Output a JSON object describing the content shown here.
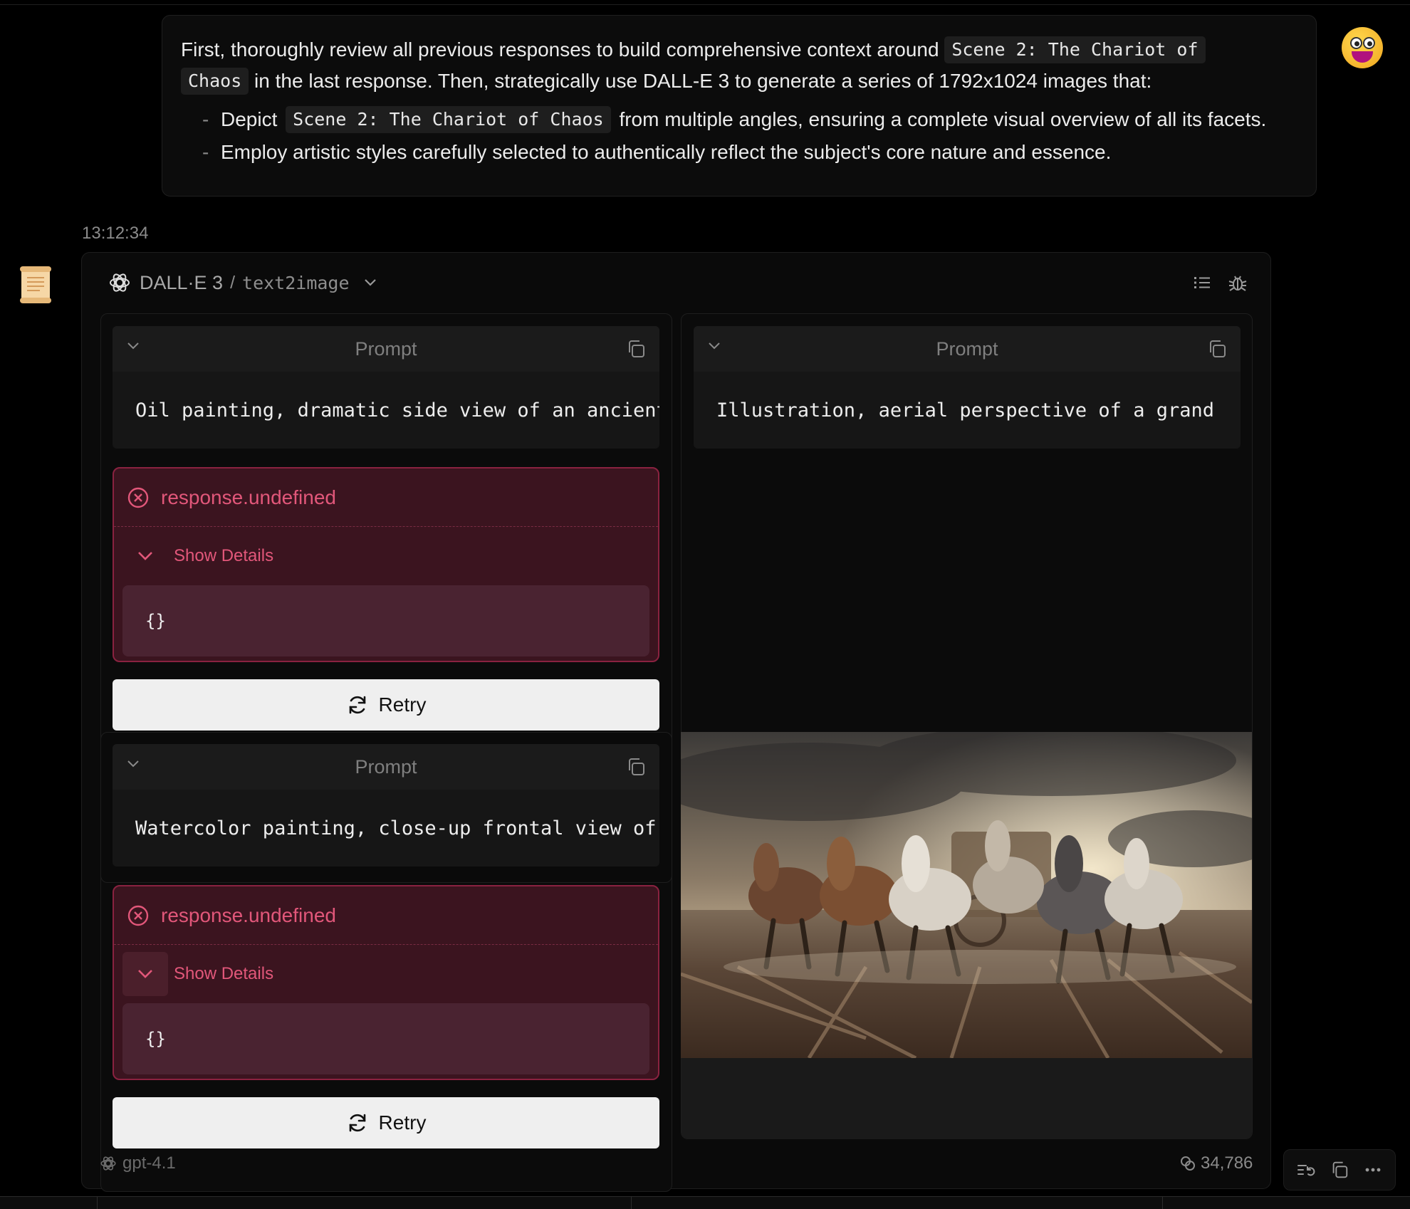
{
  "user_message": {
    "line1_prefix": "First, thoroughly review all previous responses to build comprehensive context around",
    "chip_part1": "Scene 2: The Chariot of",
    "chip_part2": "Chaos",
    "line2_suffix": "in the last response. Then, strategically use DALL-E 3 to generate a series of 1792x1024 images that:",
    "bullets": [
      {
        "prefix": "Depict",
        "chip": "Scene 2: The Chariot of Chaos",
        "suffix": "from multiple angles, ensuring a complete visual overview of all its facets."
      },
      {
        "text": "Employ artistic styles carefully selected to authentically reflect the subject's core nature and essence."
      }
    ],
    "bullet_dash": "-"
  },
  "timestamp": "13:12:34",
  "tool": {
    "name": "DALL·E 3",
    "separator": "/",
    "api": "text2image"
  },
  "prompts": [
    {
      "label": "Prompt",
      "text": "Oil painting, dramatic side view of an ancient chariot"
    },
    {
      "label": "Prompt",
      "text": "Illustration, aerial perspective of a grand"
    },
    {
      "label": "Prompt",
      "text": "Watercolor painting, close-up frontal view of"
    }
  ],
  "errors": [
    {
      "title": "response.undefined",
      "details_label": "Show Details",
      "json": "{}"
    },
    {
      "title": "response.undefined",
      "details_label": "Show Details",
      "json": "{}"
    }
  ],
  "retry_label": "Retry",
  "footer": {
    "model": "gpt-4.1",
    "tokens": "34,786"
  },
  "icons": {
    "openai": "openai-logo-icon",
    "chevron": "chevron-down-icon",
    "copy": "copy-icon",
    "error": "error-circle-icon",
    "retry": "refresh-icon"
  },
  "colors": {
    "error_text": "#e2577a",
    "error_bg": "#3b141f",
    "error_border": "#8a2240",
    "button_bg": "#efefef"
  }
}
